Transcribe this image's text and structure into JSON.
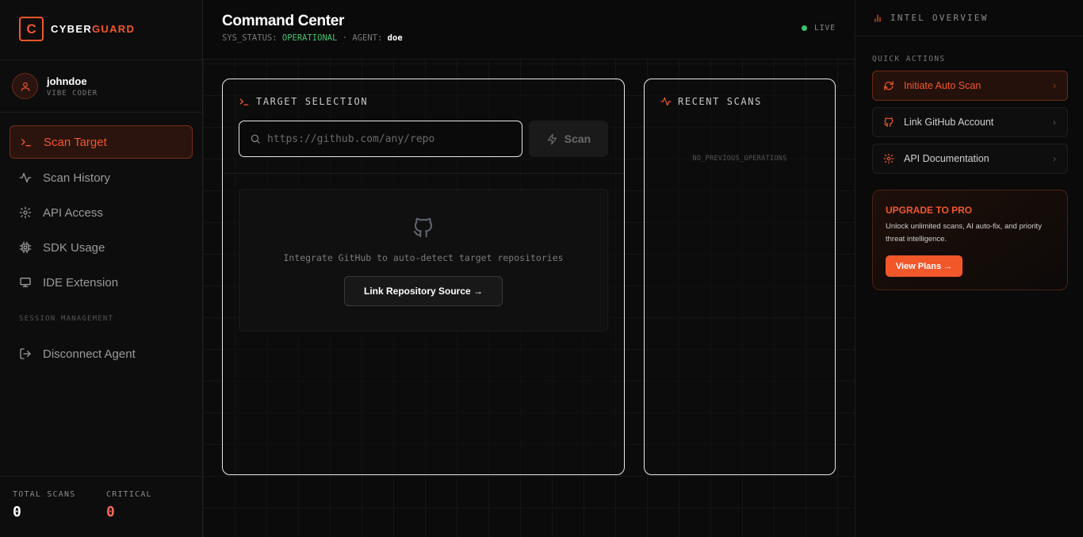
{
  "brand": {
    "logo_letter": "C",
    "name_part1": "CYBER",
    "name_part2": "GUARD",
    "accent": "#f2572a"
  },
  "user": {
    "name": "johndoe",
    "role": "VIBE CODER",
    "avatar_icon": "user-icon"
  },
  "nav": {
    "items": [
      {
        "label": "Scan Target",
        "icon": "terminal-icon",
        "active": true
      },
      {
        "label": "Scan History",
        "icon": "activity-icon",
        "active": false
      },
      {
        "label": "API Access",
        "icon": "gear-icon",
        "active": false
      },
      {
        "label": "SDK Usage",
        "icon": "chip-icon",
        "active": false
      },
      {
        "label": "IDE Extension",
        "icon": "monitor-icon",
        "active": false
      }
    ],
    "session_label": "SESSION MANAGEMENT",
    "disconnect_label": "Disconnect Agent"
  },
  "stats": {
    "total_label": "TOTAL SCANS",
    "total_value": "0",
    "critical_label": "CRITICAL",
    "critical_value": "0"
  },
  "header": {
    "title": "Command Center",
    "sys_label": "SYS_STATUS:",
    "sys_value": "OPERATIONAL",
    "separator": "·",
    "agent_label": "AGENT:",
    "agent_value": "doe",
    "live_label": "LIVE"
  },
  "target": {
    "heading": "TARGET SELECTION",
    "placeholder": "https://github.com/any/repo",
    "value": "",
    "scan_label": "Scan",
    "integrate_text": "Integrate GitHub to auto-detect target repositories",
    "link_label": "Link Repository Source →"
  },
  "recent": {
    "heading": "RECENT SCANS",
    "empty_text": "NO_PREVIOUS_OPERATIONS"
  },
  "intel": {
    "heading": "INTEL OVERVIEW",
    "quick_actions_label": "QUICK ACTIONS",
    "actions": [
      {
        "label": "Initiate Auto Scan",
        "icon": "refresh-icon"
      },
      {
        "label": "Link GitHub Account",
        "icon": "github-icon"
      },
      {
        "label": "API Documentation",
        "icon": "gear-icon"
      }
    ],
    "upgrade": {
      "title": "UPGRADE TO PRO",
      "text": "Unlock unlimited scans, AI auto-fix, and priority threat intelligence.",
      "button": "View Plans →"
    }
  },
  "colors": {
    "success": "#3ec46d",
    "critical": "#f16a5a",
    "background": "#0a0a0a"
  }
}
